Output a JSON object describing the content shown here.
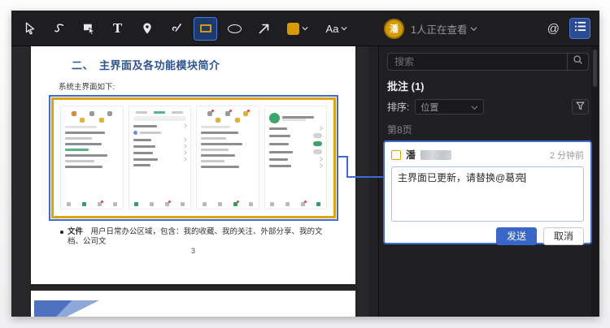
{
  "toolbar": {
    "font_tool_label": "Aa",
    "at_mention_label": "@",
    "avatar_initial": "潘",
    "viewers_label": "1人正在查看"
  },
  "sidebar": {
    "search_placeholder": "搜索",
    "comments_header": "批注 (1)",
    "sort_label": "排序:",
    "sort_value": "位置",
    "page_group": "第8页",
    "comment": {
      "author": "潘",
      "time": "2 分钟前",
      "draft_text": "主界面已更新，请替换@葛亮",
      "send_label": "发送",
      "cancel_label": "取消"
    }
  },
  "document": {
    "heading": "二、　主界面及各功能模块简介",
    "intro_line": "系统主界面如下:",
    "bullet_term": "文件",
    "bullet_text": "　用户日常办公区域，包含：我的收藏、我的关注、外部分享、我的文档、公司文",
    "page_number": "3"
  },
  "colors": {
    "accent_blue": "#3a6bd8",
    "annotation_orange": "#e0a400",
    "heading_blue": "#2f5496"
  }
}
